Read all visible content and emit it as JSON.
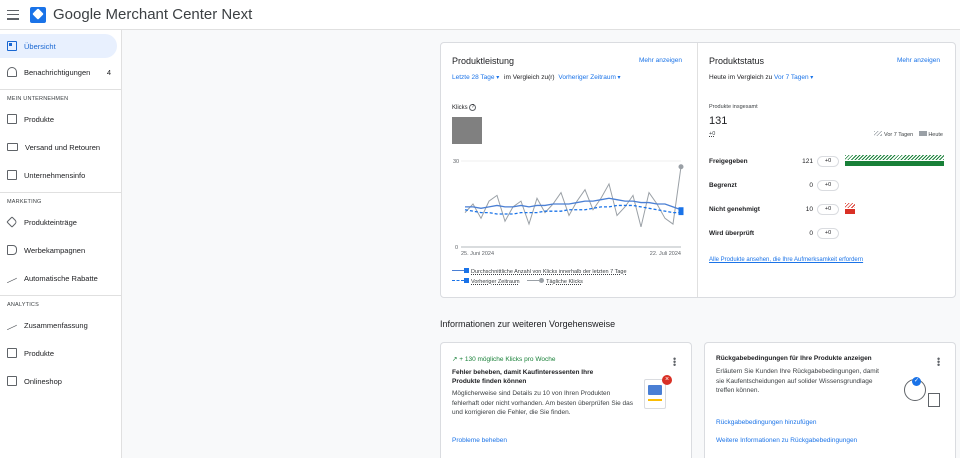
{
  "app": {
    "title": "Google Merchant Center Next"
  },
  "sidebar": {
    "items": [
      {
        "label": "Übersicht",
        "icon": "dashboard-icon"
      },
      {
        "label": "Benachrichtigungen",
        "badge": "4",
        "icon": "bell-icon"
      }
    ],
    "sections": [
      {
        "header": "MEIN UNTERNEHMEN",
        "items": [
          {
            "label": "Produkte",
            "icon": "box-icon"
          },
          {
            "label": "Versand und Retouren",
            "icon": "truck-icon"
          },
          {
            "label": "Unternehmensinfo",
            "icon": "building-icon"
          }
        ]
      },
      {
        "header": "MARKETING",
        "items": [
          {
            "label": "Produkteinträge",
            "icon": "tag-icon"
          },
          {
            "label": "Werbekampagnen",
            "icon": "megaphone-icon"
          },
          {
            "label": "Automatische Rabatte",
            "icon": "trend-icon"
          }
        ]
      },
      {
        "header": "ANALYTICS",
        "items": [
          {
            "label": "Zusammenfassung",
            "icon": "trend-icon"
          },
          {
            "label": "Produkte",
            "icon": "box-icon"
          },
          {
            "label": "Onlineshop",
            "icon": "storefront-icon"
          }
        ]
      }
    ]
  },
  "performance": {
    "title": "Produktleistung",
    "more": "Mehr anzeigen",
    "range": "Letzte 28 Tage",
    "compare_text": "im Vergleich zu(r)",
    "compare_value": "Vorheriger Zeitraum",
    "metric": "Klicks",
    "legend": {
      "avg": "Durchschnittliche Anzahl von Klicks innerhalb der letzten 7 Tage",
      "prev": "Vorheriger Zeitraum",
      "daily": "Tägliche Klicks"
    }
  },
  "chart_data": {
    "type": "line",
    "x_start": "25. Juni 2024",
    "x_end": "22. Juli 2024",
    "ylim": [
      0,
      30
    ],
    "yticks": [
      "30",
      "0"
    ],
    "series": [
      {
        "name": "Tägliche Klicks",
        "values": [
          12,
          15,
          10,
          16,
          18,
          9,
          14,
          16,
          8,
          17,
          12,
          15,
          19,
          11,
          16,
          20,
          13,
          17,
          22,
          11,
          14,
          18,
          7,
          19,
          15,
          10,
          8,
          28
        ]
      },
      {
        "name": "Durchschnittliche Anzahl von Klicks innerhalb der letzten 7 Tage",
        "values": [
          14,
          14,
          13.5,
          14,
          14.5,
          14,
          14,
          14.5,
          14,
          14.5,
          14.5,
          15,
          15,
          15,
          15.5,
          16,
          16,
          16.5,
          17,
          16.5,
          16,
          16,
          15.5,
          15.5,
          15,
          15,
          14,
          13
        ]
      },
      {
        "name": "Vorheriger Zeitraum",
        "values": [
          13,
          12.5,
          12,
          12,
          11.5,
          11.5,
          11.5,
          12,
          12,
          12,
          12.5,
          12.5,
          12.5,
          13,
          13,
          13,
          13.5,
          14,
          14,
          14.5,
          14.5,
          14.5,
          14,
          13.5,
          13,
          12.5,
          12,
          12
        ]
      }
    ],
    "colors": {
      "daily": "#9aa0a6",
      "avg": "#4a7fd4",
      "prev": "#1a73e8"
    }
  },
  "product_status": {
    "title": "Produktstatus",
    "more": "Mehr anzeigen",
    "compare_text": "Heute im Vergleich zu",
    "compare_value": "Vor 7 Tagen",
    "total_label": "Produkte insgesamt",
    "total": "131",
    "total_delta": "+0",
    "legend_prev": "Vor 7 Tagen",
    "legend_today": "Heute",
    "rows": [
      {
        "label": "Freigegeben",
        "value": "121",
        "delta": "+0",
        "fraction": 1.0,
        "color": "#188038"
      },
      {
        "label": "Begrenzt",
        "value": "0",
        "delta": "+0",
        "fraction": 0,
        "color": "#f9ab00"
      },
      {
        "label": "Nicht genehmigt",
        "value": "10",
        "delta": "+0",
        "fraction": 0.08,
        "color": "#d93025"
      },
      {
        "label": "Wird überprüft",
        "value": "0",
        "delta": "+0",
        "fraction": 0,
        "color": "#1a73e8"
      }
    ],
    "link": "Alle Produkte ansehen, die Ihre Aufmerksamkeit erfordern"
  },
  "next_steps": {
    "title": "Informationen zur weiteren Vorgehensweise",
    "card1": {
      "boost": "+ 130 mögliche Klicks pro Woche",
      "heading": "Fehler beheben, damit Kaufinteressenten Ihre Produkte finden können",
      "body": "Möglicherweise sind Details zu 10 von Ihren Produkten fehlerhaft oder nicht vorhanden. Am besten überprüfen Sie das und korrigieren die Fehler, die Sie finden.",
      "action": "Probleme beheben"
    },
    "card2": {
      "heading": "Rückgabebedingungen für Ihre Produkte anzeigen",
      "body": "Erläutern Sie Kunden Ihre Rückgabebedingungen, damit sie Kaufentscheidungen auf solider Wissensgrundlage treffen können.",
      "action1": "Rückgabebedingungen hinzufügen",
      "action2": "Weitere Informationen zu Rückgabebedingungen"
    }
  }
}
